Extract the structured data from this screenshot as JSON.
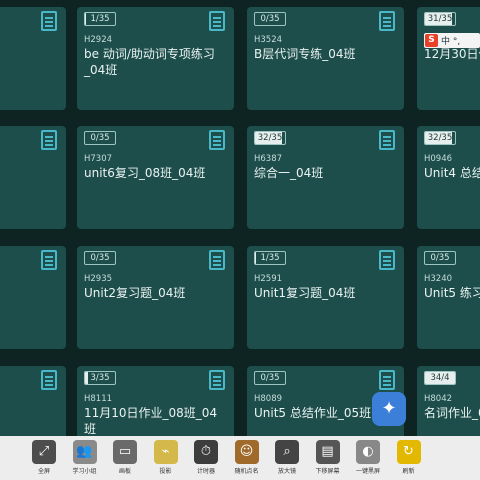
{
  "cards": [
    {
      "badge": "",
      "code": "",
      "title": "班"
    },
    {
      "badge": "1/35",
      "code": "H2924",
      "title": "be 动词/助动词专项练习_04班"
    },
    {
      "badge": "0/35",
      "code": "H3524",
      "title": "B层代词专练_04班"
    },
    {
      "badge": "31/35",
      "code": "",
      "title": "12月30日作"
    },
    {
      "badge": "",
      "code": "",
      "title": "04班"
    },
    {
      "badge": "0/35",
      "code": "H7307",
      "title": "unit6复习_08班_04班"
    },
    {
      "badge": "32/35",
      "code": "H6387",
      "title": "综合一_04班"
    },
    {
      "badge": "32/35",
      "code": "H0946",
      "title": "Unit4 总结班"
    },
    {
      "badge": "",
      "code": "",
      "title": "_04班"
    },
    {
      "badge": "0/35",
      "code": "H2935",
      "title": "Unit2复习题_04班"
    },
    {
      "badge": "1/35",
      "code": "H2591",
      "title": "Unit1复习题_04班"
    },
    {
      "badge": "0/35",
      "code": "H3240",
      "title": "Unit5 练习"
    },
    {
      "badge": "",
      "code": "",
      "title": "1班_04班"
    },
    {
      "badge": "3/35",
      "code": "H8111",
      "title": "11月10日作业_08班_04班"
    },
    {
      "badge": "0/35",
      "code": "H8089",
      "title": "Unit5 总结作业_05班"
    },
    {
      "badge": "34/4",
      "code": "H8042",
      "title": "名词作业_04"
    }
  ],
  "ime": {
    "label": "中 °,"
  },
  "toolbar": {
    "items": [
      {
        "label": "全屏",
        "icon": "expand-icon",
        "color": "#4d4d4d",
        "glyph": "⤢"
      },
      {
        "label": "学习小组",
        "icon": "group-icon",
        "color": "#8a8a8a",
        "glyph": "👥"
      },
      {
        "label": "画板",
        "icon": "board-icon",
        "color": "#6a6a6a",
        "glyph": "▭"
      },
      {
        "label": "投影",
        "icon": "projector-icon",
        "color": "#d4b84a",
        "glyph": "⌁"
      },
      {
        "label": "计时器",
        "icon": "timer-icon",
        "color": "#3d3d3d",
        "glyph": "⏱"
      },
      {
        "label": "随机点名",
        "icon": "random-call-icon",
        "color": "#a06a2a",
        "glyph": "☺"
      },
      {
        "label": "放大镜",
        "icon": "magnifier-icon",
        "color": "#444",
        "glyph": "⌕"
      },
      {
        "label": "下移屏幕",
        "icon": "screen-down-icon",
        "color": "#555",
        "glyph": "▤"
      },
      {
        "label": "一键黑屏",
        "icon": "blackscreen-icon",
        "color": "#888",
        "glyph": "◐"
      },
      {
        "label": "刷新",
        "icon": "refresh-icon",
        "color": "#e2b800",
        "glyph": "↻"
      }
    ]
  }
}
